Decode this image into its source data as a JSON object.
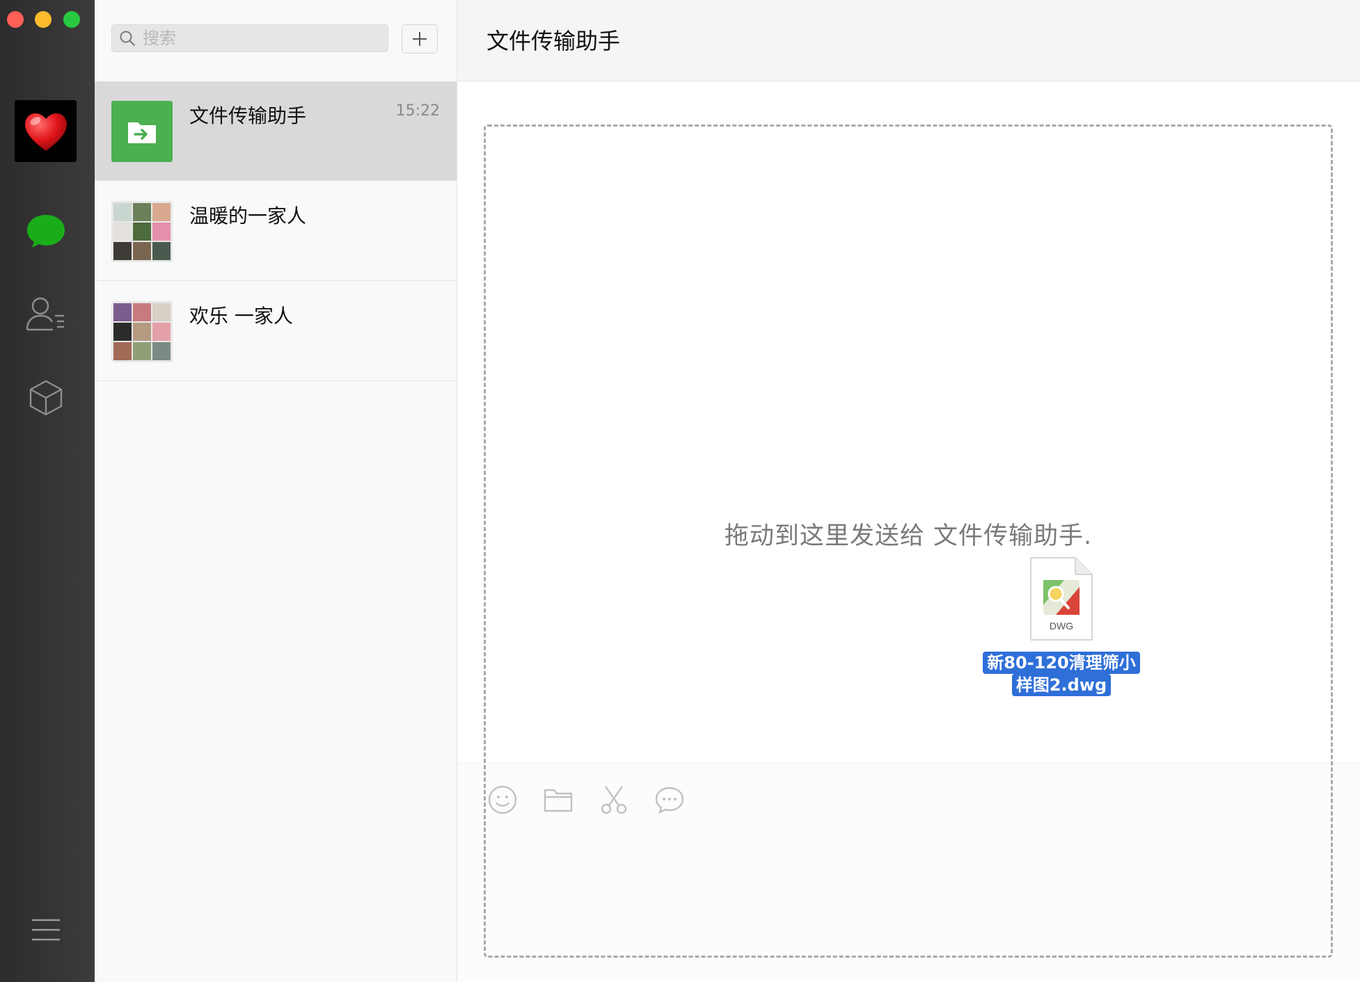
{
  "window": {
    "controls": [
      "close",
      "minimize",
      "zoom"
    ]
  },
  "rail": {
    "avatar_icon": "heart-icon",
    "items": [
      {
        "name": "chat",
        "icon": "chat-bubble-icon",
        "active": true
      },
      {
        "name": "contacts",
        "icon": "contacts-icon",
        "active": false
      },
      {
        "name": "mini-programs",
        "icon": "cube-icon",
        "active": false
      },
      {
        "name": "menu",
        "icon": "hamburger-menu-icon",
        "active": false
      }
    ]
  },
  "search": {
    "placeholder": "搜索",
    "value": ""
  },
  "add_button": {
    "icon": "plus-icon"
  },
  "conversations": [
    {
      "name": "文件传输助手",
      "time": "15:22",
      "selected": true,
      "avatar": "file-transfer-icon"
    },
    {
      "name": "温暖的一家人",
      "time": "",
      "selected": false,
      "avatar": "group-mosaic"
    },
    {
      "name": "欢乐 一家人",
      "time": "",
      "selected": false,
      "avatar": "group-mosaic"
    }
  ],
  "chat": {
    "title": "文件传输助手",
    "drop_hint": "拖动到这里发送给 文件传输助手.",
    "toolbar": [
      "emoji-icon",
      "folder-icon",
      "scissors-icon",
      "chat-history-icon"
    ]
  },
  "dragged_file": {
    "extension": "DWG",
    "name_line1": "新80-120清理筛小",
    "name_line2": "样图2.dwg"
  },
  "colors": {
    "rail_bg": "#2e2e2e",
    "accent_green": "#1aad19",
    "file_transfer_green": "#4caf50",
    "selection_blue": "#2f6fd8",
    "selected_row": "#d9d9d9"
  }
}
